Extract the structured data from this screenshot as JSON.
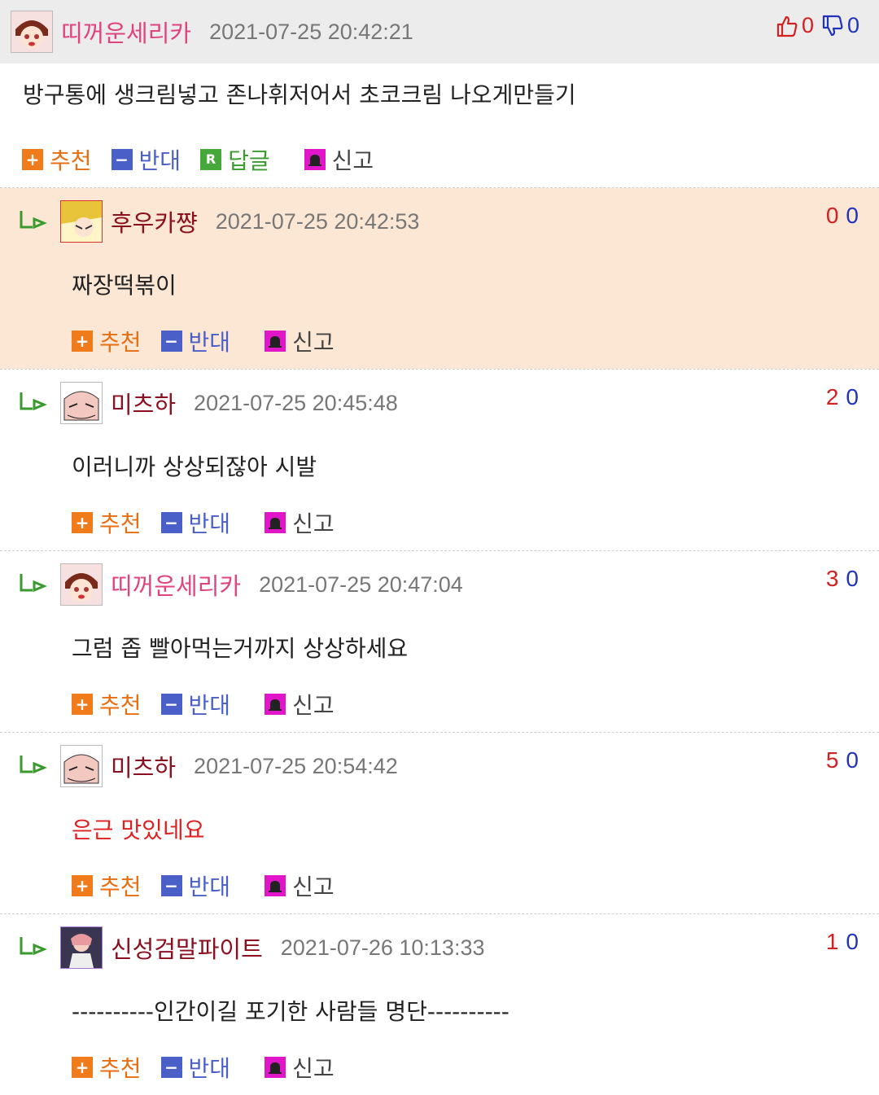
{
  "post": {
    "author": "띠꺼운세리카",
    "date": "2021-07-25 20:42:21",
    "up": "0",
    "down": "0",
    "body": "방구통에 생크림넣고 존나휘저어서 초코크림 나오게만들기",
    "actions": {
      "recommend": "추천",
      "oppose": "반대",
      "reply": "답글",
      "report": "신고"
    }
  },
  "comments": [
    {
      "author": "후우카쨩",
      "date": "2021-07-25 20:42:53",
      "up": "0",
      "down": "0",
      "body": "짜장떡볶이"
    },
    {
      "author": "미츠하",
      "date": "2021-07-25 20:45:48",
      "up": "2",
      "down": "0",
      "body": "이러니까 상상되잖아 시발"
    },
    {
      "author": "띠꺼운세리카",
      "date": "2021-07-25 20:47:04",
      "up": "3",
      "down": "0",
      "body": "그럼 좁 빨아먹는거까지 상상하세요"
    },
    {
      "author": "미츠하",
      "date": "2021-07-25 20:54:42",
      "up": "5",
      "down": "0",
      "body": "은근 맛있네요"
    },
    {
      "author": "신성검말파이트",
      "date": "2021-07-26 10:13:33",
      "up": "1",
      "down": "0",
      "body": "----------인간이길 포기한 사람들 명단----------"
    }
  ],
  "comment_actions": {
    "recommend": "추천",
    "oppose": "반대",
    "report": "신고"
  },
  "colors": {
    "highlight": "#fce7d5",
    "up": "#d42020",
    "down": "#2233bb",
    "recommend": "#f07b1a",
    "oppose": "#4a5fc8",
    "reply": "#46a83a",
    "report": "#e016c8"
  }
}
